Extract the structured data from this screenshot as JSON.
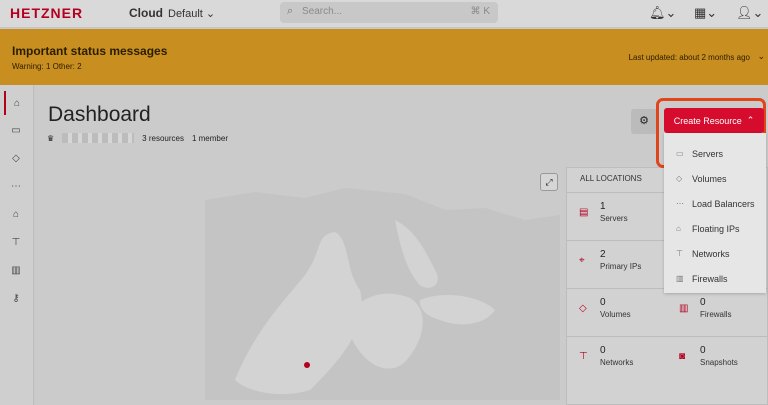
{
  "header": {
    "logo": "HETZNER",
    "logo_sub": "Cloud",
    "project": "Default",
    "search_placeholder": "Search...",
    "search_shortcut": "⌘ K"
  },
  "banner": {
    "title": "Important status messages",
    "stats": "Warning: 1   Other: 2",
    "updated": "Last updated: about 2 months ago"
  },
  "dashboard": {
    "title": "Dashboard",
    "resources": "3 resources",
    "members": "1 member"
  },
  "panel": {
    "header": "ALL LOCATIONS",
    "items": [
      {
        "count": "1",
        "label": "Servers"
      },
      {
        "count": "2",
        "label": "Primary IPs"
      },
      {
        "count": "0",
        "label": "Volumes"
      },
      {
        "count": "0",
        "label": "Firewalls"
      },
      {
        "count": "0",
        "label": "Networks"
      },
      {
        "count": "0",
        "label": "Snapshots"
      }
    ]
  },
  "create": {
    "label": "Create Resource",
    "items": [
      "Servers",
      "Volumes",
      "Load Balancers",
      "Floating IPs",
      "Networks",
      "Firewalls"
    ]
  },
  "icons": {
    "home": "home-icon",
    "servers": "server-icon",
    "volumes": "cube-icon",
    "networks": "network-icon",
    "firewalls": "firewall-icon",
    "keys": "key-icon"
  },
  "colors": {
    "brand": "#d50c2d",
    "banner": "#c88e1f",
    "highlight": "#e0451b"
  }
}
